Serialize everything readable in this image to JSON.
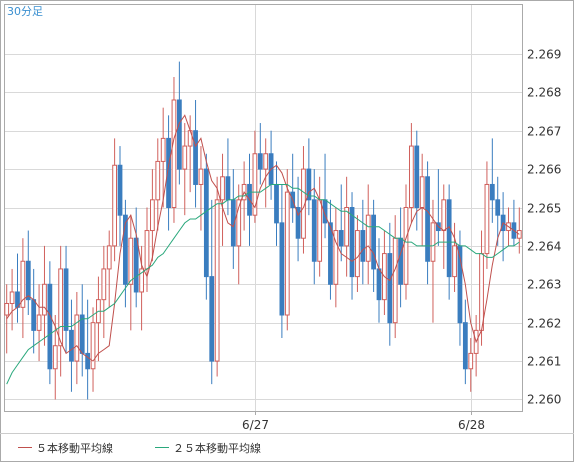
{
  "chart_data": {
    "type": "candlestick",
    "period_label": "30分足",
    "y_ticks": [
      2.26,
      2.261,
      2.262,
      2.263,
      2.264,
      2.265,
      2.266,
      2.267,
      2.268,
      2.269
    ],
    "y_tick_labels": [
      "2.260",
      "2.261",
      "2.262",
      "2.263",
      "2.264",
      "2.265",
      "2.266",
      "2.267",
      "2.268",
      "2.269"
    ],
    "ylim": [
      2.2597,
      2.2703
    ],
    "x_count": 96,
    "x_ticks": [
      {
        "index": 46,
        "label": "6/27"
      },
      {
        "index": 86,
        "label": "6/28"
      }
    ],
    "grid": true,
    "colors": {
      "up": "#d0605c",
      "down": "#3a7dbf",
      "ma5": "#c0504d",
      "ma25": "#2aa87c",
      "grid": "#d9d9d9",
      "frame": "#aaaaaa",
      "period_label": "#3a8fd0"
    },
    "series": [
      {
        "name": "５本移動平均線",
        "color": "#c0504d",
        "values": [
          2.2621,
          2.2623,
          2.2624,
          2.2626,
          2.2627,
          2.2626,
          2.2624,
          2.2624,
          2.2622,
          2.2619,
          2.2615,
          2.2612,
          2.2613,
          2.2614,
          2.2612,
          2.2611,
          2.261,
          2.2612,
          2.2613,
          2.2614,
          2.2625,
          2.2638,
          2.2646,
          2.2648,
          2.2643,
          2.2635,
          2.2632,
          2.2637,
          2.2645,
          2.2652,
          2.2661,
          2.2668,
          2.2672,
          2.2674,
          2.267,
          2.2666,
          2.2668,
          2.2662,
          2.2657,
          2.2655,
          2.265,
          2.2646,
          2.2645,
          2.265,
          2.2654,
          2.2652,
          2.265,
          2.2655,
          2.2658,
          2.266,
          2.2661,
          2.2659,
          2.2655,
          2.2652,
          2.2648,
          2.265,
          2.2654,
          2.2655,
          2.2652,
          2.2648,
          2.2645,
          2.2641,
          2.2638,
          2.2637,
          2.2636,
          2.2637,
          2.2639,
          2.264,
          2.2638,
          2.2634,
          2.2632,
          2.2631,
          2.2634,
          2.2638,
          2.2642,
          2.2646,
          2.2649,
          2.265,
          2.2649,
          2.2647,
          2.2645,
          2.2644,
          2.2645,
          2.2642,
          2.2637,
          2.263,
          2.262,
          2.2615,
          2.2618,
          2.2626,
          2.2635,
          2.2642,
          2.2646,
          2.2645,
          2.2644,
          2.2643
        ]
      },
      {
        "name": "２５本移動平均線",
        "color": "#2aa87c",
        "values": [
          2.2604,
          2.2607,
          2.2609,
          2.2611,
          2.2613,
          2.2614,
          2.2615,
          2.2616,
          2.2617,
          2.2618,
          2.2619,
          2.2619,
          2.2619,
          2.262,
          2.2621,
          2.2621,
          2.2622,
          2.2623,
          2.2623,
          2.2624,
          2.2625,
          2.2627,
          2.2629,
          2.2631,
          2.2632,
          2.2633,
          2.2634,
          2.2635,
          2.2637,
          2.2638,
          2.264,
          2.2642,
          2.2644,
          2.2646,
          2.2647,
          2.2647,
          2.2648,
          2.2649,
          2.265,
          2.2651,
          2.2651,
          2.2652,
          2.2652,
          2.2653,
          2.2653,
          2.2654,
          2.2654,
          2.2654,
          2.2655,
          2.2656,
          2.2656,
          2.2656,
          2.2656,
          2.2655,
          2.2655,
          2.2654,
          2.2653,
          2.2653,
          2.2652,
          2.2652,
          2.2651,
          2.265,
          2.2649,
          2.2649,
          2.2648,
          2.2647,
          2.2646,
          2.2645,
          2.2645,
          2.2645,
          2.2644,
          2.2643,
          2.2642,
          2.2642,
          2.2641,
          2.2641,
          2.264,
          2.264,
          2.264,
          2.264,
          2.2641,
          2.2641,
          2.2641,
          2.2641,
          2.264,
          2.264,
          2.2639,
          2.2638,
          2.2638,
          2.2637,
          2.2637,
          2.2638,
          2.2639,
          2.264,
          2.264,
          2.2641
        ]
      }
    ],
    "candles": [
      [
        2.2622,
        2.263,
        2.2612,
        2.2625
      ],
      [
        2.2625,
        2.2634,
        2.2618,
        2.2628
      ],
      [
        2.2628,
        2.2638,
        2.262,
        2.2624
      ],
      [
        2.2624,
        2.2642,
        2.2616,
        2.2636
      ],
      [
        2.2636,
        2.2644,
        2.2622,
        2.2626
      ],
      [
        2.2626,
        2.2634,
        2.2612,
        2.2618
      ],
      [
        2.2618,
        2.263,
        2.261,
        2.2622
      ],
      [
        2.2622,
        2.264,
        2.2614,
        2.263
      ],
      [
        2.263,
        2.2636,
        2.2604,
        2.2608
      ],
      [
        2.2608,
        2.2622,
        2.26,
        2.2614
      ],
      [
        2.2614,
        2.264,
        2.2606,
        2.2634
      ],
      [
        2.2634,
        2.264,
        2.2612,
        2.2618
      ],
      [
        2.2618,
        2.2626,
        2.2602,
        2.261
      ],
      [
        2.261,
        2.2628,
        2.2604,
        2.2622
      ],
      [
        2.2622,
        2.263,
        2.2606,
        2.2612
      ],
      [
        2.2612,
        2.2626,
        2.26,
        2.2608
      ],
      [
        2.2608,
        2.2624,
        2.2602,
        2.262
      ],
      [
        2.262,
        2.2632,
        2.261,
        2.2626
      ],
      [
        2.2626,
        2.264,
        2.2616,
        2.2634
      ],
      [
        2.2634,
        2.2644,
        2.2624,
        2.264
      ],
      [
        2.264,
        2.2668,
        2.2636,
        2.2661
      ],
      [
        2.2661,
        2.2666,
        2.264,
        2.2648
      ],
      [
        2.2648,
        2.2652,
        2.2624,
        2.263
      ],
      [
        2.263,
        2.2648,
        2.2618,
        2.2642
      ],
      [
        2.2642,
        2.265,
        2.2624,
        2.2628
      ],
      [
        2.2628,
        2.264,
        2.2618,
        2.2634
      ],
      [
        2.2634,
        2.265,
        2.2628,
        2.2644
      ],
      [
        2.2644,
        2.266,
        2.2636,
        2.2652
      ],
      [
        2.2652,
        2.2668,
        2.2644,
        2.2662
      ],
      [
        2.2662,
        2.2676,
        2.265,
        2.2668
      ],
      [
        2.2668,
        2.2674,
        2.2644,
        2.265
      ],
      [
        2.265,
        2.2684,
        2.2646,
        2.2678
      ],
      [
        2.2678,
        2.2688,
        2.2656,
        2.266
      ],
      [
        2.266,
        2.2672,
        2.2648,
        2.2666
      ],
      [
        2.2666,
        2.2674,
        2.2654,
        2.267
      ],
      [
        2.267,
        2.2678,
        2.265,
        2.2656
      ],
      [
        2.2656,
        2.2666,
        2.2644,
        2.266
      ],
      [
        2.266,
        2.2664,
        2.2626,
        2.2632
      ],
      [
        2.2632,
        2.2652,
        2.2604,
        2.261
      ],
      [
        2.261,
        2.2658,
        2.2606,
        2.2652
      ],
      [
        2.2652,
        2.2664,
        2.264,
        2.2658
      ],
      [
        2.2658,
        2.2668,
        2.2648,
        2.2652
      ],
      [
        2.2652,
        2.266,
        2.2634,
        2.264
      ],
      [
        2.264,
        2.2656,
        2.263,
        2.2652
      ],
      [
        2.2652,
        2.2662,
        2.2644,
        2.2656
      ],
      [
        2.2656,
        2.2664,
        2.264,
        2.2648
      ],
      [
        2.2648,
        2.267,
        2.2646,
        2.2664
      ],
      [
        2.2664,
        2.2672,
        2.2656,
        2.266
      ],
      [
        2.266,
        2.2668,
        2.265,
        2.2664
      ],
      [
        2.2664,
        2.267,
        2.2652,
        2.2656
      ],
      [
        2.2656,
        2.2662,
        2.264,
        2.2646
      ],
      [
        2.2646,
        2.2656,
        2.2616,
        2.2622
      ],
      [
        2.2622,
        2.266,
        2.2618,
        2.2654
      ],
      [
        2.2654,
        2.2664,
        2.2646,
        2.265
      ],
      [
        2.265,
        2.2658,
        2.2636,
        2.2642
      ],
      [
        2.2642,
        2.2666,
        2.2638,
        2.266
      ],
      [
        2.266,
        2.2668,
        2.2648,
        2.2652
      ],
      [
        2.2652,
        2.266,
        2.263,
        2.2636
      ],
      [
        2.2636,
        2.2658,
        2.2632,
        2.2652
      ],
      [
        2.2652,
        2.2664,
        2.2642,
        2.2646
      ],
      [
        2.2646,
        2.2652,
        2.2626,
        2.263
      ],
      [
        2.263,
        2.265,
        2.2624,
        2.2644
      ],
      [
        2.2644,
        2.2656,
        2.2636,
        2.264
      ],
      [
        2.264,
        2.2658,
        2.2632,
        2.265
      ],
      [
        2.265,
        2.2654,
        2.2626,
        2.2632
      ],
      [
        2.2632,
        2.2648,
        2.2628,
        2.2644
      ],
      [
        2.2644,
        2.2652,
        2.263,
        2.2636
      ],
      [
        2.2636,
        2.2656,
        2.263,
        2.2648
      ],
      [
        2.2648,
        2.2652,
        2.2628,
        2.2634
      ],
      [
        2.2634,
        2.2642,
        2.262,
        2.2626
      ],
      [
        2.2626,
        2.2644,
        2.2622,
        2.2638
      ],
      [
        2.2638,
        2.2646,
        2.2614,
        2.262
      ],
      [
        2.262,
        2.2648,
        2.2616,
        2.2642
      ],
      [
        2.2642,
        2.265,
        2.2624,
        2.263
      ],
      [
        2.263,
        2.2656,
        2.2626,
        2.265
      ],
      [
        2.265,
        2.2672,
        2.2646,
        2.2666
      ],
      [
        2.2666,
        2.267,
        2.2644,
        2.265
      ],
      [
        2.265,
        2.2664,
        2.264,
        2.2658
      ],
      [
        2.2658,
        2.2662,
        2.263,
        2.2636
      ],
      [
        2.2636,
        2.2652,
        2.262,
        2.2646
      ],
      [
        2.2646,
        2.266,
        2.264,
        2.2644
      ],
      [
        2.2644,
        2.2656,
        2.2634,
        2.2652
      ],
      [
        2.2652,
        2.2656,
        2.2626,
        2.2632
      ],
      [
        2.2632,
        2.2646,
        2.2628,
        2.264
      ],
      [
        2.264,
        2.2644,
        2.2614,
        2.262
      ],
      [
        2.262,
        2.2626,
        2.2604,
        2.2608
      ],
      [
        2.2608,
        2.2616,
        2.2602,
        2.2612
      ],
      [
        2.2612,
        2.2622,
        2.2606,
        2.2618
      ],
      [
        2.2618,
        2.2644,
        2.2614,
        2.2638
      ],
      [
        2.2638,
        2.2662,
        2.2634,
        2.2656
      ],
      [
        2.2656,
        2.2668,
        2.2646,
        2.2652
      ],
      [
        2.2652,
        2.2658,
        2.264,
        2.2648
      ],
      [
        2.2648,
        2.2654,
        2.2636,
        2.2644
      ],
      [
        2.2644,
        2.265,
        2.264,
        2.2646
      ],
      [
        2.2646,
        2.2652,
        2.264,
        2.2642
      ],
      [
        2.2642,
        2.265,
        2.2638,
        2.2644
      ]
    ],
    "legend": [
      {
        "label": "５本移動平均線",
        "color": "#c0504d"
      },
      {
        "label": "２５本移動平均線",
        "color": "#2aa87c"
      }
    ]
  }
}
